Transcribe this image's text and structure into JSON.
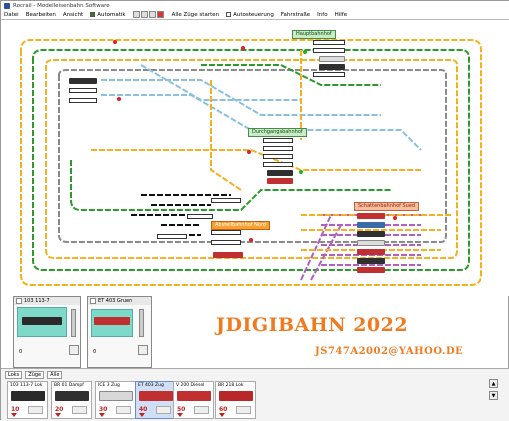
{
  "window": {
    "title": "Rocrail - Modelleisenbahn Software"
  },
  "menubar": {
    "items": [
      "Datei",
      "Bearbeiten",
      "Ansicht",
      "Automatik",
      "Alle Züge starten",
      "Autosteuerung",
      "Fahrstraße",
      "Info",
      "Hilfe"
    ],
    "auto_label": "Automatik",
    "autostop_label": "Autosteuerung"
  },
  "labels": {
    "station_top": "Hauptbahnhof",
    "station_middle": "Durchgangsbahnhof",
    "station_orange": "Abstellbahnhof Nord",
    "station_pink": "Schattenbahnhof Sued"
  },
  "watermark": {
    "title": "JDIGIBAHN 2022",
    "email": "JS747A2002@YAHOO.DE"
  },
  "left_panel": {
    "title": "103 113-7",
    "speed": "0"
  },
  "mid_panel": {
    "title": "ET 403 Gruen",
    "speed": "0"
  },
  "bottom": {
    "tabs": [
      "Loks",
      "Züge",
      "Alle"
    ],
    "slots": [
      {
        "name": "103 113-7 Lok",
        "num": "10"
      },
      {
        "name": "BR 01 Dampf",
        "num": "20"
      },
      {
        "name": "ICE 3 Zug",
        "num": "30"
      },
      {
        "name": "ET 403 Zug",
        "num": "40"
      },
      {
        "name": "V 200 Diesel",
        "num": "50"
      },
      {
        "name": "BR 218 Lok",
        "num": "60"
      }
    ]
  },
  "colors": {
    "track_orange": "#f5b020",
    "track_green": "#2a9a2a",
    "track_blue": "#8ac0e0",
    "track_gray": "#8a8a8a",
    "track_purple": "#b060c0",
    "track_black": "#101010",
    "watermark": "#f07a20"
  }
}
